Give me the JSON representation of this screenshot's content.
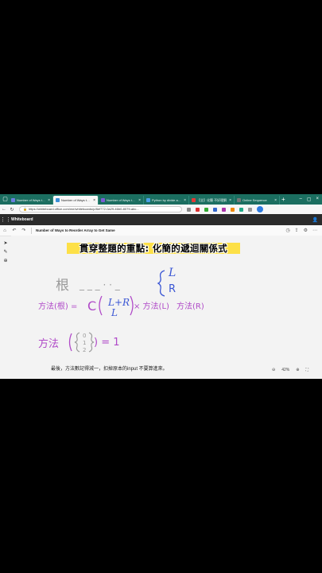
{
  "tabs": [
    {
      "label": "Number of Ways to Reorder Array",
      "color": "#6b7fe0",
      "active": false
    },
    {
      "label": "Number of Ways to Reorder Array",
      "color": "#3a8fd8",
      "active": true
    },
    {
      "label": "Number of Ways to Reo...",
      "color": "#7c5cd6",
      "active": false
    },
    {
      "label": "Python by divide and co...",
      "color": "#4aa0e8",
      "active": false
    },
    {
      "label": "【全】化簡 不好理解",
      "color": "#e53935",
      "active": false
    },
    {
      "label": "Online Sequence",
      "color": "#777777",
      "active": false
    }
  ],
  "address": {
    "url": "https://whiteboard.office.com/me/whiteboards/p/8ef772-0a29-46b0-8079-abc..."
  },
  "app": {
    "title": "Whiteboard"
  },
  "board": {
    "name": "Number of Ways to Reorder Array to Get Same"
  },
  "banner": {
    "text": "貫穿整題的重點: 化簡的遞迴關係式"
  },
  "caption": {
    "text": "最後，方法數記得減一，扣掉原本的input 不要算進來。"
  },
  "zoom": {
    "level": "42%"
  },
  "handwriting": {
    "root": "根",
    "dashes": "_ _ _  · ·  _",
    "L": "L",
    "R": "R",
    "method_root": "方法(根) =",
    "C": "C",
    "L_plus_R": "L+R",
    "L_bottom": "L",
    "times1": "× 方法(L)",
    "times2": "方法(R)",
    "method_base": "方法",
    "zero": "0",
    "one": "1",
    "two": "2",
    "equals_one": ") = 1"
  }
}
